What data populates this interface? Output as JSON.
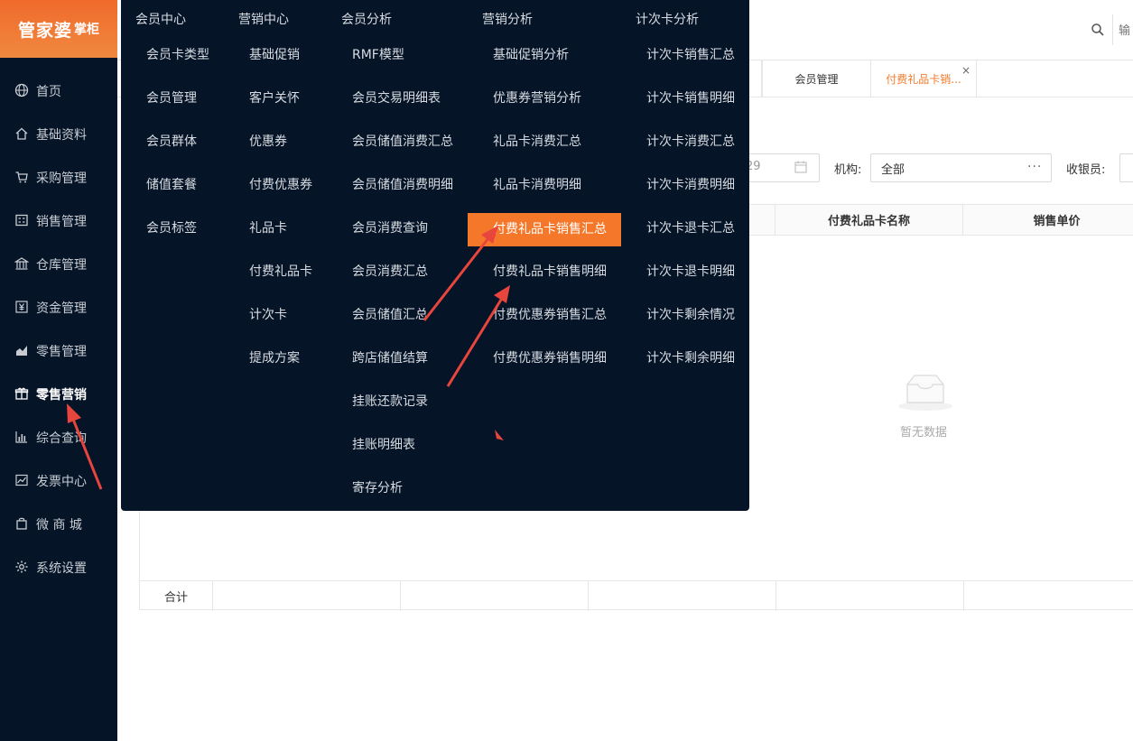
{
  "app": {
    "logo_main": "管家婆",
    "logo_sub": "掌柜"
  },
  "sidebar": {
    "items": [
      {
        "label": "首页",
        "icon": "globe-icon"
      },
      {
        "label": "基础资料",
        "icon": "home-icon"
      },
      {
        "label": "采购管理",
        "icon": "cart-icon"
      },
      {
        "label": "销售管理",
        "icon": "calculator-icon"
      },
      {
        "label": "仓库管理",
        "icon": "warehouse-icon"
      },
      {
        "label": "资金管理",
        "icon": "yen-icon"
      },
      {
        "label": "零售管理",
        "icon": "chart-area-icon"
      },
      {
        "label": "零售营销",
        "icon": "gift-icon"
      },
      {
        "label": "综合查询",
        "icon": "bar-chart-icon"
      },
      {
        "label": "发票中心",
        "icon": "line-chart-icon"
      },
      {
        "label": "微 商 城",
        "icon": "bag-icon"
      },
      {
        "label": "系统设置",
        "icon": "gear-icon"
      }
    ],
    "active_index": 7
  },
  "header": {
    "search_placeholder": "输"
  },
  "tabs": [
    {
      "label": "会员管理"
    },
    {
      "label": "付费礼品卡销...",
      "close": "×"
    }
  ],
  "filters": {
    "date_value": "29",
    "org_label": "机构:",
    "org_value": "全部",
    "org_more": "···",
    "cashier_label": "收银员:"
  },
  "table": {
    "columns": [
      "付费礼品卡名称",
      "销售单价"
    ],
    "empty_text": "暂无数据",
    "footer_label": "合计"
  },
  "mega_menu": {
    "columns": [
      {
        "title": "会员中心",
        "items": [
          "会员卡类型",
          "会员管理",
          "会员群体",
          "储值套餐",
          "会员标签"
        ]
      },
      {
        "title": "营销中心",
        "items": [
          "基础促销",
          "客户关怀",
          "优惠券",
          "付费优惠券",
          "礼品卡",
          "付费礼品卡",
          "计次卡",
          "提成方案"
        ]
      },
      {
        "title": "会员分析",
        "items": [
          "RMF模型",
          "会员交易明细表",
          "会员储值消费汇总",
          "会员储值消费明细",
          "会员消费查询",
          "会员消费汇总",
          "会员储值汇总",
          "跨店储值结算",
          "挂账还款记录",
          "挂账明细表",
          "寄存分析"
        ]
      },
      {
        "title": "营销分析",
        "items": [
          "基础促销分析",
          "优惠券营销分析",
          "礼品卡消费汇总",
          "礼品卡消费明细",
          "付费礼品卡销售汇总",
          "付费礼品卡销售明细",
          "付费优惠券销售汇总",
          "付费优惠券销售明细"
        ],
        "highlight_index": 4
      },
      {
        "title": "计次卡分析",
        "items": [
          "计次卡销售汇总",
          "计次卡销售明细",
          "计次卡消费汇总",
          "计次卡消费明细",
          "计次卡退卡汇总",
          "计次卡退卡明细",
          "计次卡剩余情况",
          "计次卡剩余明细"
        ]
      }
    ]
  },
  "colors": {
    "sidebar_bg": "#051427",
    "accent": "#f5782a",
    "annotation_arrow": "#e8453c"
  }
}
